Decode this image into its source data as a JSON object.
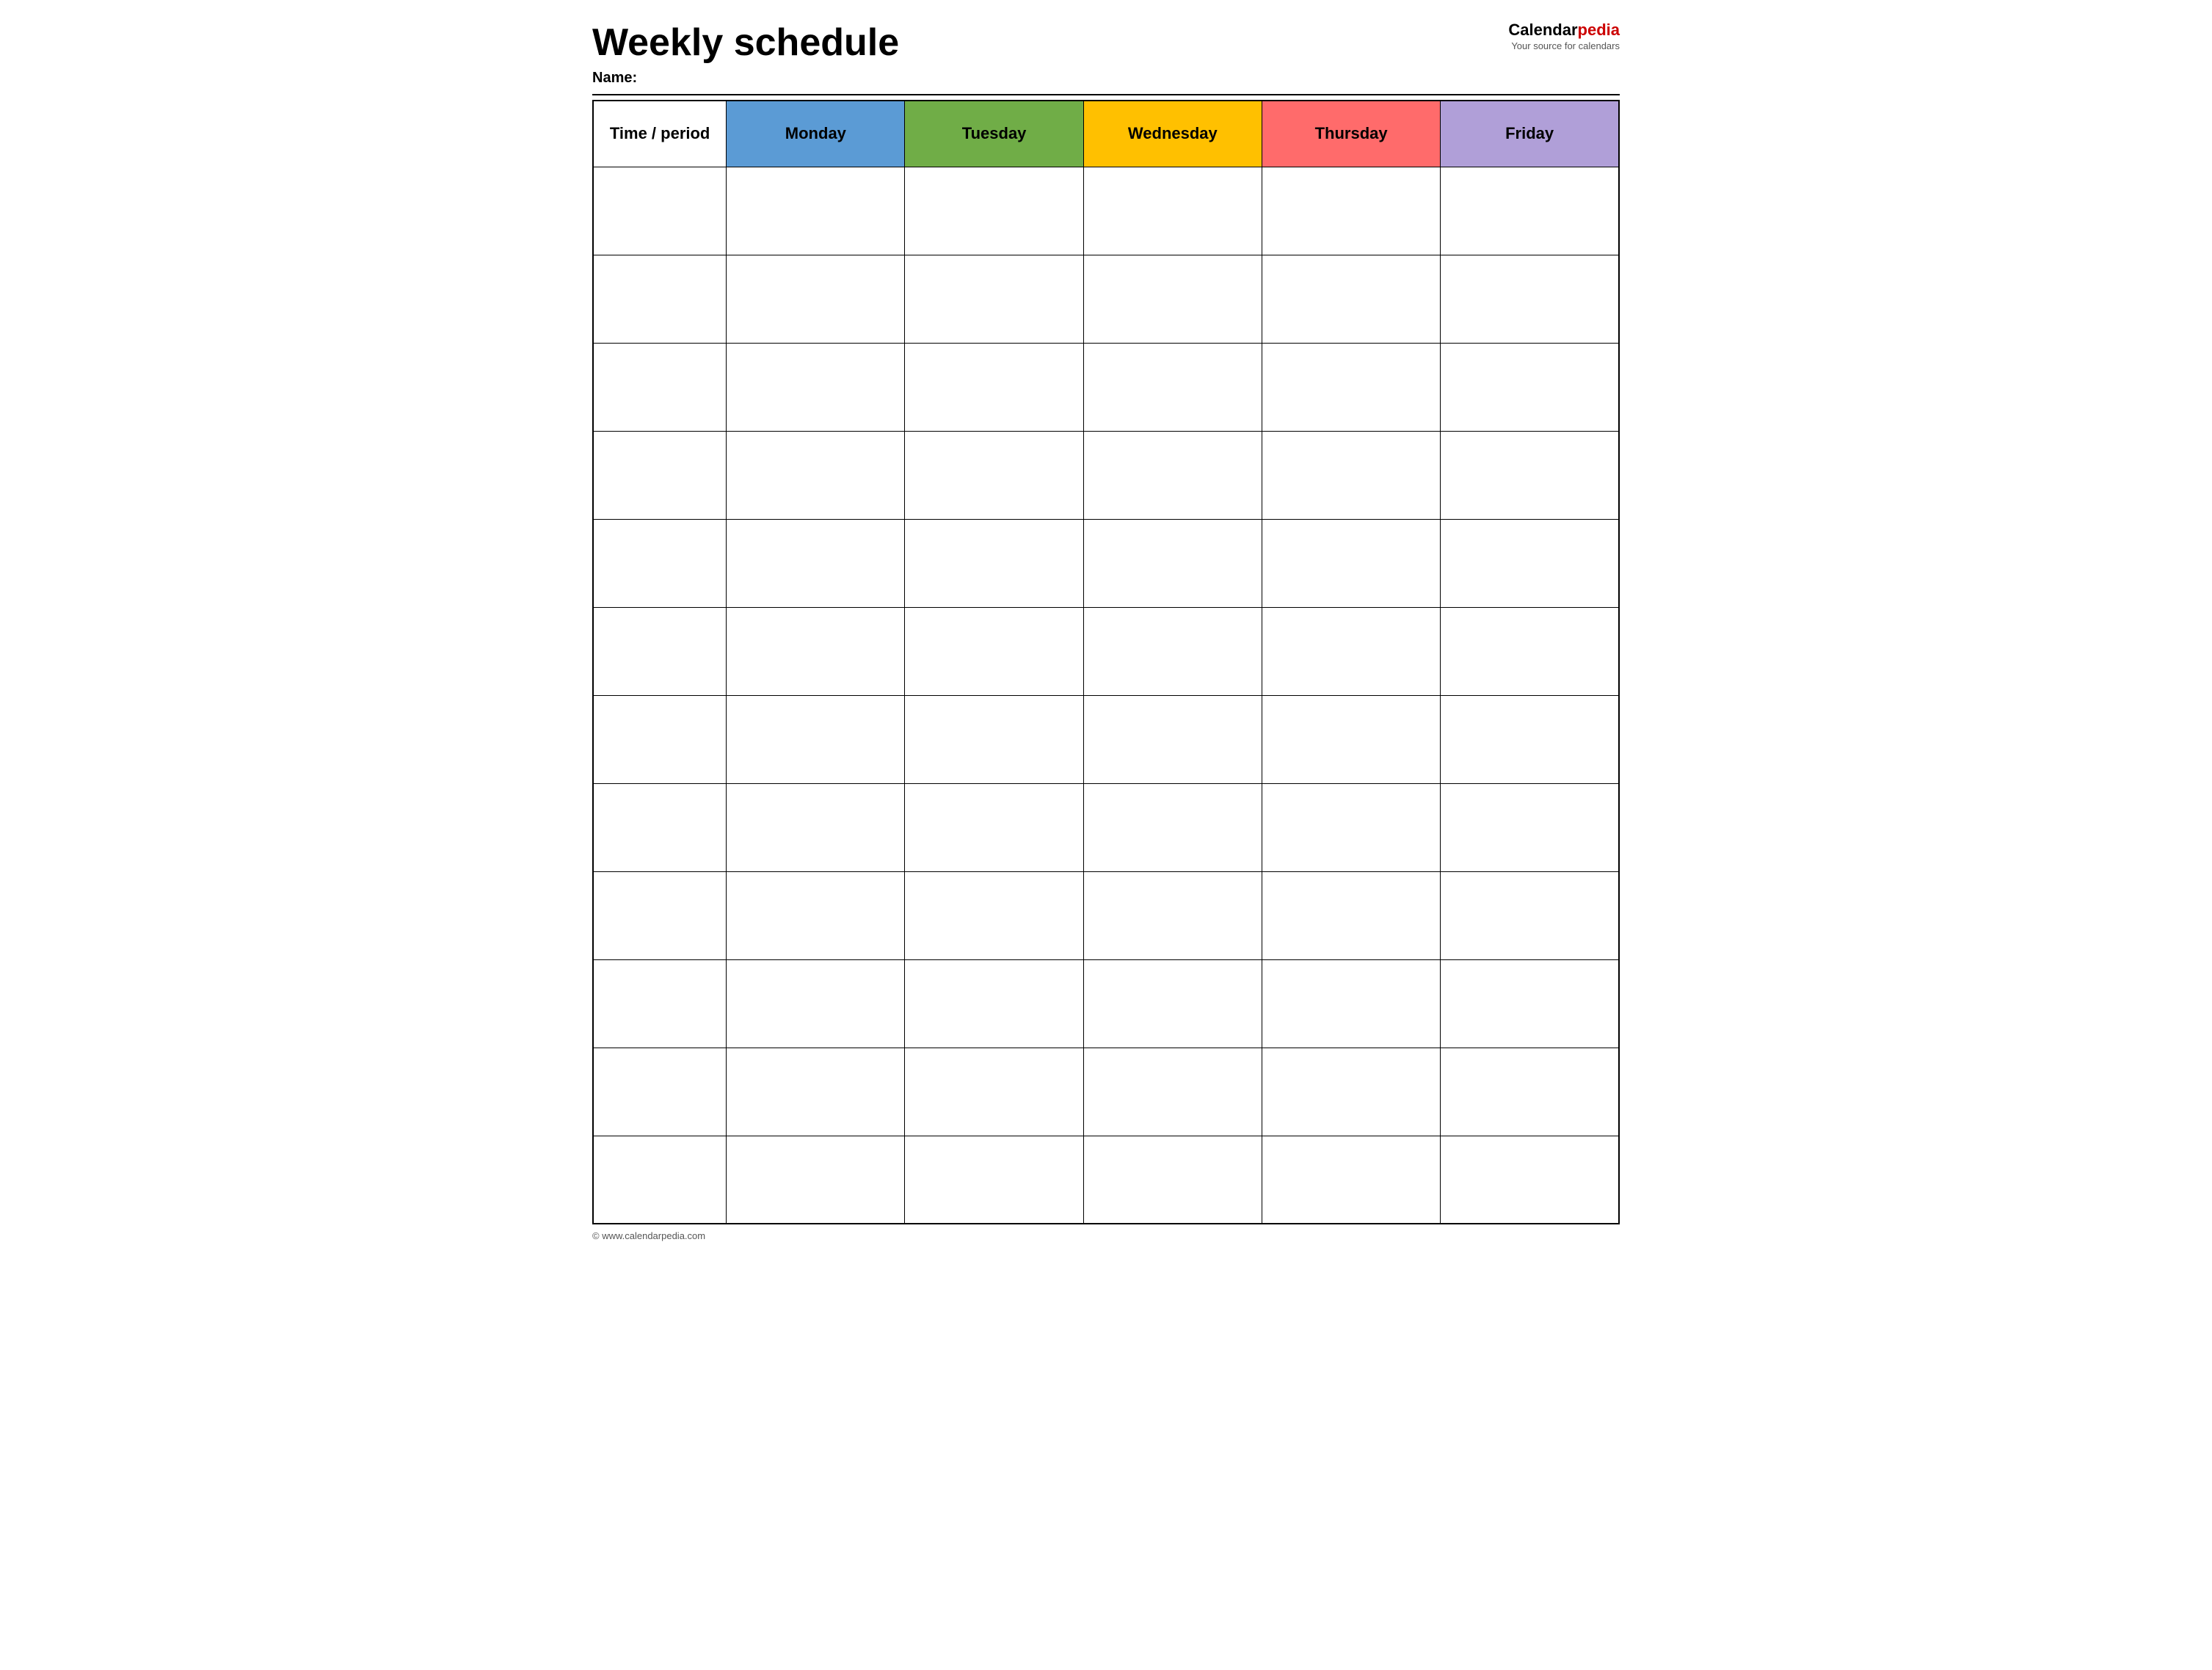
{
  "header": {
    "title": "Weekly schedule",
    "name_label": "Name:",
    "logo_brand": "Calendar",
    "logo_brand_red": "pedia",
    "logo_tagline": "Your source for calendars"
  },
  "table": {
    "columns": [
      {
        "id": "time",
        "label": "Time / period",
        "color": "#ffffff"
      },
      {
        "id": "monday",
        "label": "Monday",
        "color": "#5b9bd5"
      },
      {
        "id": "tuesday",
        "label": "Tuesday",
        "color": "#70ad47"
      },
      {
        "id": "wednesday",
        "label": "Wednesday",
        "color": "#ffc000"
      },
      {
        "id": "thursday",
        "label": "Thursday",
        "color": "#ff6b6b"
      },
      {
        "id": "friday",
        "label": "Friday",
        "color": "#b09fd8"
      }
    ],
    "row_count": 12
  },
  "footer": {
    "copyright": "© www.calendarpedia.com"
  }
}
